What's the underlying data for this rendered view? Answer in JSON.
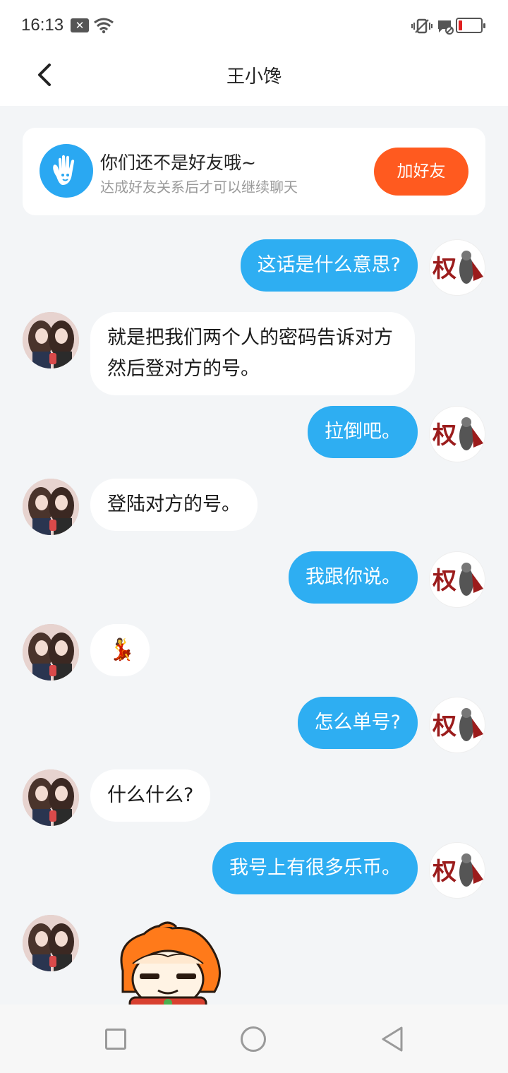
{
  "status_bar": {
    "time": "16:13",
    "icons": [
      "x-notification-icon",
      "wifi-icon",
      "vibrate-icon",
      "message-blocked-icon",
      "battery-low-icon"
    ],
    "battery_color": "#e02020"
  },
  "header": {
    "title": "王小馋",
    "back_icon": "chevron-left-icon"
  },
  "friend_card": {
    "title": "你们还不是好友哦~",
    "subtitle": "达成好友关系后才可以继续聊天",
    "button_label": "加好友",
    "button_color": "#ff5a1f",
    "icon": "hand-icon"
  },
  "messages": [
    {
      "from": "me",
      "text": "这话是什么意思?",
      "avatar_label": "权"
    },
    {
      "from": "them",
      "text": "就是把我们两个人的密码告诉对方然后登对方的号。"
    },
    {
      "from": "me",
      "text": "拉倒吧。",
      "avatar_label": "权"
    },
    {
      "from": "them",
      "text": "登陆对方的号。"
    },
    {
      "from": "me",
      "text": "我跟你说。",
      "avatar_label": "权"
    },
    {
      "from": "them",
      "text": "💃",
      "type": "emoji"
    },
    {
      "from": "me",
      "text": "怎么单号?",
      "avatar_label": "权"
    },
    {
      "from": "them",
      "text": "什么什么?"
    },
    {
      "from": "me",
      "text": "我号上有很多乐币。",
      "avatar_label": "权"
    },
    {
      "from": "them",
      "type": "sticker",
      "sticker": "orange-haired-character-sticker"
    }
  ],
  "theme": {
    "bubble_me": "#2eaef2",
    "bubble_them": "#ffffff",
    "background": "#f3f5f7"
  },
  "bottom_nav": {
    "icons": [
      "recent-apps-icon",
      "home-icon",
      "back-icon"
    ]
  }
}
